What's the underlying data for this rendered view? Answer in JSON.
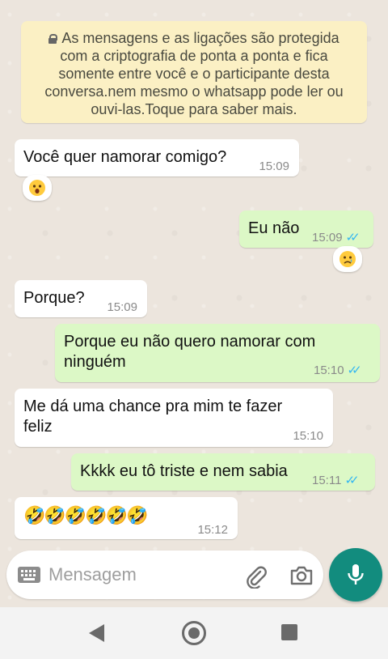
{
  "encryption_notice": "As mensagens e as ligações são protegida com a criptografia de ponta a ponta e fica somente entre você e o participante desta conversa.nem mesmo o whatsapp pode ler ou ouvi-las.Toque para saber mais.",
  "messages": [
    {
      "direction": "in",
      "text": "Você quer namorar comigo?",
      "time": "15:09",
      "reaction": "astonished-face"
    },
    {
      "direction": "out",
      "text": "Eu não",
      "time": "15:09",
      "read": true,
      "reaction": "sad-tear-face"
    },
    {
      "direction": "in",
      "text": "Porque?",
      "time": "15:09"
    },
    {
      "direction": "out",
      "text_line1": "Porque eu não quero namorar com",
      "text_line2": "ninguém",
      "time": "15:10",
      "read": true
    },
    {
      "direction": "in",
      "text_line1": "Me dá uma chance pra mim te fazer",
      "text_line2": "feliz",
      "time": "15:10"
    },
    {
      "direction": "out",
      "text": "Kkkk eu tô triste e nem sabia",
      "time": "15:11",
      "read": true
    },
    {
      "direction": "in",
      "text": "🤣🤣🤣🤣🤣🤣",
      "time": "15:12"
    }
  ],
  "composer": {
    "placeholder": "Mensagem"
  },
  "icons": {
    "keyboard": "keyboard-icon",
    "attach": "paperclip-icon",
    "camera": "camera-icon",
    "mic": "microphone-icon"
  },
  "colors": {
    "incoming_bubble": "#ffffff",
    "outgoing_bubble": "#dcf8c6",
    "notice_bg": "#fbf0c4",
    "read_ticks": "#34b7f1",
    "mic_button": "#128c7e"
  }
}
